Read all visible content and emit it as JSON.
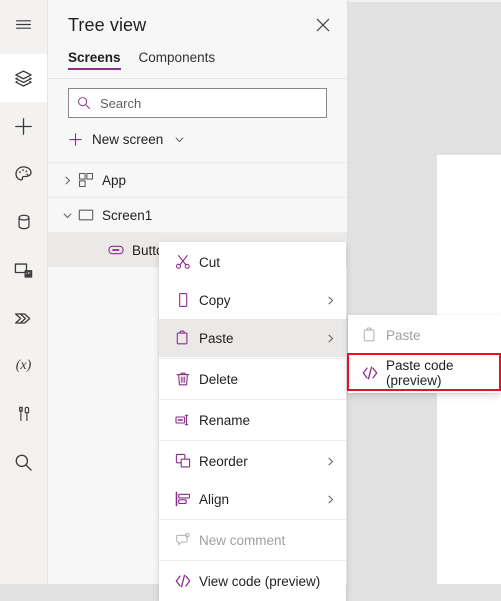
{
  "theme": {
    "accent": "#8B2F8B",
    "highlight_box_color": "#E81123",
    "panel_bg": "#F8F7F7",
    "rail_bg": "#F3F2F1",
    "backdrop": "#E1E1E1",
    "canvas": "#FFFFFF"
  },
  "rail": {
    "items": [
      {
        "icon": "hamburger-menu-icon",
        "name": "menu",
        "active": false
      },
      {
        "icon": "layers-icon",
        "name": "tree-view",
        "active": true
      },
      {
        "icon": "plus-icon",
        "name": "insert",
        "active": false
      },
      {
        "icon": "palette-icon",
        "name": "themes",
        "active": false
      },
      {
        "icon": "database-icon",
        "name": "data",
        "active": false
      },
      {
        "icon": "media-icon",
        "name": "media",
        "active": false
      },
      {
        "icon": "power-automate-icon",
        "name": "power-automate",
        "active": false
      },
      {
        "icon": "variables-icon",
        "name": "variables",
        "active": false
      },
      {
        "icon": "tools-icon",
        "name": "app-checker",
        "active": false
      },
      {
        "icon": "search-icon",
        "name": "search",
        "active": false
      }
    ]
  },
  "panel": {
    "title": "Tree view",
    "close_label": "Close",
    "tabs": [
      {
        "label": "Screens",
        "selected": true
      },
      {
        "label": "Components",
        "selected": false
      }
    ],
    "search": {
      "value": "",
      "placeholder": "Search"
    },
    "new_screen": {
      "label": "New screen"
    },
    "tree": [
      {
        "label": "App",
        "depth": 0,
        "twisty": "collapsed",
        "icon": "app-grid-icon",
        "highlighted": false,
        "more": false
      },
      {
        "label": "Screen1",
        "depth": 0,
        "twisty": "expanded",
        "icon": "screen-icon",
        "highlighted": false,
        "more": false
      },
      {
        "label": "Button",
        "depth": 1,
        "twisty": "none",
        "icon": "button-control-icon",
        "highlighted": true,
        "more": true
      }
    ],
    "more_dots": "· · ·"
  },
  "context_menu": {
    "items": [
      {
        "label": "Cut",
        "icon": "scissors-icon",
        "submenu": false,
        "disabled": false,
        "highlighted": false,
        "sep_after": false
      },
      {
        "label": "Copy",
        "icon": "copy-icon",
        "submenu": true,
        "disabled": false,
        "highlighted": false,
        "sep_after": false
      },
      {
        "label": "Paste",
        "icon": "paste-icon",
        "submenu": true,
        "disabled": false,
        "highlighted": true,
        "sep_after": true
      },
      {
        "label": "Delete",
        "icon": "trash-icon",
        "submenu": false,
        "disabled": false,
        "highlighted": false,
        "sep_after": true
      },
      {
        "label": "Rename",
        "icon": "rename-icon",
        "submenu": false,
        "disabled": false,
        "highlighted": false,
        "sep_after": true
      },
      {
        "label": "Reorder",
        "icon": "reorder-icon",
        "submenu": true,
        "disabled": false,
        "highlighted": false,
        "sep_after": false
      },
      {
        "label": "Align",
        "icon": "align-icon",
        "submenu": true,
        "disabled": false,
        "highlighted": false,
        "sep_after": true
      },
      {
        "label": "New comment",
        "icon": "comment-icon",
        "submenu": false,
        "disabled": true,
        "highlighted": false,
        "sep_after": true
      },
      {
        "label": "View code (preview)",
        "icon": "code-icon",
        "submenu": false,
        "disabled": false,
        "highlighted": false,
        "sep_after": false
      }
    ]
  },
  "context_submenu": {
    "items": [
      {
        "label": "Paste",
        "icon": "paste-icon",
        "disabled": true,
        "boxed": false
      },
      {
        "label": "Paste code (preview)",
        "icon": "code-icon",
        "disabled": false,
        "boxed": true
      }
    ]
  }
}
